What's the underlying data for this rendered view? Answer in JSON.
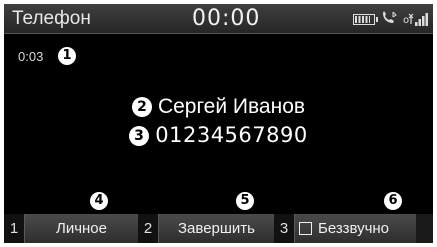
{
  "status_bar": {
    "app_title": "Телефон",
    "clock": "00:00",
    "icons": [
      "battery-icon",
      "phone-bluetooth-icon",
      "signal-icon"
    ]
  },
  "call": {
    "duration": "0:03",
    "caller_name": "Сергей Иванов",
    "caller_number": "01234567890"
  },
  "callouts": [
    "1",
    "2",
    "3",
    "4",
    "5",
    "6"
  ],
  "softkeys": [
    {
      "number": "1",
      "label": "Личное"
    },
    {
      "number": "2",
      "label": "Завершить"
    },
    {
      "number": "3",
      "label": "Беззвучно"
    }
  ]
}
